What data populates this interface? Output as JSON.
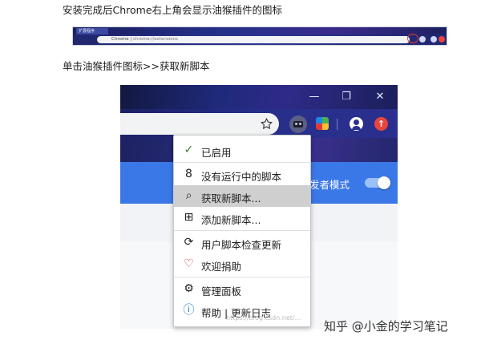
{
  "instructions": {
    "line1": "安装完成后Chrome右上角会显示油猴插件的图标",
    "line2": "单击油猴插件图标>>获取新脚本"
  },
  "small_screenshot": {
    "tab_title": "扩展程序",
    "omnibox_scheme": "Chrome | ",
    "omnibox_url": "chrome://extensions"
  },
  "browser": {
    "window_buttons": {
      "minimize": "—",
      "restore": "❐",
      "close": "✕"
    },
    "dev_mode_label": "发者模式",
    "update_glyph": "↑"
  },
  "menu": {
    "items": [
      {
        "label": "已启用",
        "icon": "check-icon",
        "glyph": "✓",
        "color": "#2e7d32"
      },
      {
        "label": "没有运行中的脚本",
        "icon": "no-script-icon",
        "glyph": "8",
        "color": "#222222"
      },
      {
        "label": "获取新脚本...",
        "icon": "search-icon",
        "glyph": "⌕",
        "color": "#222222",
        "selected": true
      },
      {
        "label": "添加新脚本...",
        "icon": "plus-box-icon",
        "glyph": "⊞",
        "color": "#222222"
      },
      {
        "label": "用户脚本检查更新",
        "icon": "refresh-icon",
        "glyph": "⟳",
        "color": "#222222"
      },
      {
        "label": "欢迎捐助",
        "icon": "heart-icon",
        "glyph": "♡",
        "color": "#d32f2f"
      },
      {
        "label": "管理面板",
        "icon": "gear-icon",
        "glyph": "⚙",
        "color": "#222222"
      },
      {
        "label": "帮助 | 更新日志",
        "icon": "info-icon",
        "glyph": "ⓘ",
        "color": "#1976d2"
      }
    ]
  },
  "watermark": {
    "text": "知乎 @小金的学习笔记",
    "faint_text": "https://blog.csdn.net/..."
  },
  "colors": {
    "galaxy_dark": "#1e2a7a",
    "extensions_blue": "#3b78e7",
    "menu_selected": "#cfcfcf"
  }
}
